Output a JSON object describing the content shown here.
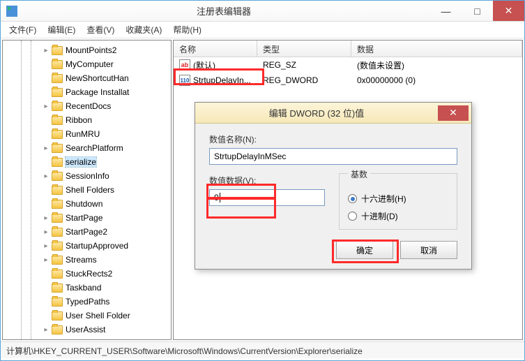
{
  "window": {
    "title": "注册表编辑器"
  },
  "controls": {
    "min": "—",
    "max": "□",
    "close": "✕"
  },
  "menu": [
    "文件(F)",
    "编辑(E)",
    "查看(V)",
    "收藏夹(A)",
    "帮助(H)"
  ],
  "tree": [
    {
      "label": "MountPoints2",
      "exp": "▸"
    },
    {
      "label": "MyComputer",
      "exp": ""
    },
    {
      "label": "NewShortcutHan",
      "exp": ""
    },
    {
      "label": "Package Installat",
      "exp": ""
    },
    {
      "label": "RecentDocs",
      "exp": "▸"
    },
    {
      "label": "Ribbon",
      "exp": ""
    },
    {
      "label": "RunMRU",
      "exp": ""
    },
    {
      "label": "SearchPlatform",
      "exp": "▸"
    },
    {
      "label": "serialize",
      "exp": "",
      "selected": true
    },
    {
      "label": "SessionInfo",
      "exp": "▸"
    },
    {
      "label": "Shell Folders",
      "exp": ""
    },
    {
      "label": "Shutdown",
      "exp": ""
    },
    {
      "label": "StartPage",
      "exp": "▸"
    },
    {
      "label": "StartPage2",
      "exp": "▸"
    },
    {
      "label": "StartupApproved",
      "exp": "▸"
    },
    {
      "label": "Streams",
      "exp": "▸"
    },
    {
      "label": "StuckRects2",
      "exp": ""
    },
    {
      "label": "Taskband",
      "exp": ""
    },
    {
      "label": "TypedPaths",
      "exp": ""
    },
    {
      "label": "User Shell Folder",
      "exp": ""
    },
    {
      "label": "UserAssist",
      "exp": "▸"
    }
  ],
  "list": {
    "headers": {
      "name": "名称",
      "type": "类型",
      "data": "数据"
    },
    "rows": [
      {
        "icon": "sz",
        "name": "(默认)",
        "type": "REG_SZ",
        "data": "(数值未设置)"
      },
      {
        "icon": "dw",
        "name": "StrtupDelayIn...",
        "type": "REG_DWORD",
        "data": "0x00000000 (0)"
      }
    ]
  },
  "dialog": {
    "title": "编辑 DWORD (32 位)值",
    "name_label": "数值名称(N):",
    "name_value": "StrtupDelayInMSec",
    "data_label": "数值数据(V):",
    "data_value": "0",
    "base_label": "基数",
    "radio_hex": "十六进制(H)",
    "radio_dec": "十进制(D)",
    "ok": "确定",
    "cancel": "取消"
  },
  "statusbar": "计算机\\HKEY_CURRENT_USER\\Software\\Microsoft\\Windows\\CurrentVersion\\Explorer\\serialize"
}
